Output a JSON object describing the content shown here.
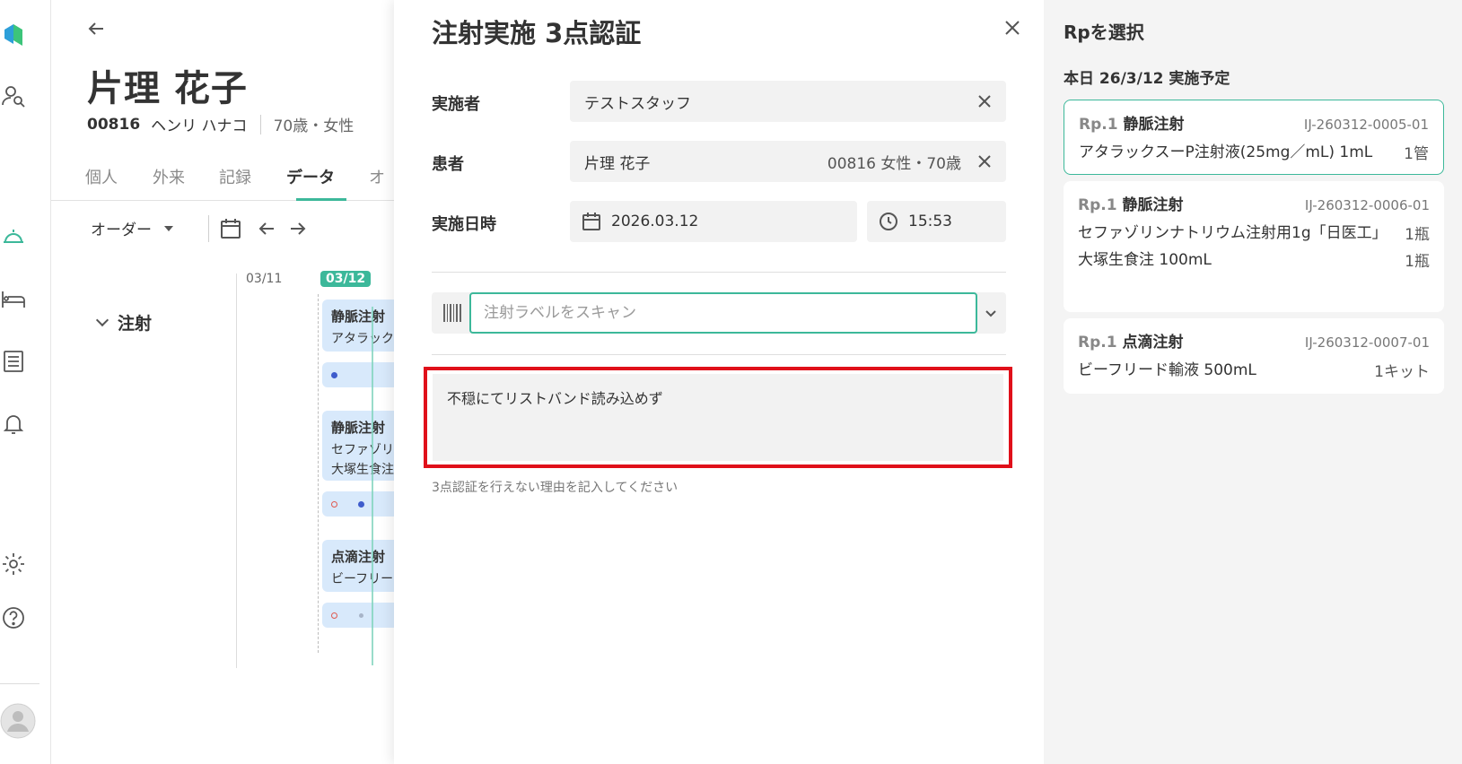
{
  "patient": {
    "name": "片理 花子",
    "id": "00816",
    "kana": "ヘンリ ハナコ",
    "age_sex": "70歳・女性"
  },
  "tabs": [
    "個人",
    "外来",
    "記録",
    "データ",
    "オ"
  ],
  "active_tab": "データ",
  "toolbar": {
    "dropdown": "オーダー"
  },
  "timeline": {
    "date_prev": "03/11",
    "date_today": "03/12",
    "section": "注射",
    "cards": [
      {
        "title": "静脈注射",
        "lines": [
          "アタラック"
        ]
      },
      {
        "title": "静脈注射",
        "lines": [
          "セファゾリ",
          "大塚生食注"
        ]
      },
      {
        "title": "点滴注射",
        "lines": [
          "ビーフリー"
        ]
      }
    ]
  },
  "modal": {
    "title": "注射実施 3点認証",
    "performer_label": "実施者",
    "performer_value": "テストスタッフ",
    "patient_label": "患者",
    "patient_value": "片理 花子",
    "patient_meta": "00816 女性・70歳",
    "datetime_label": "実施日時",
    "date_value": "2026.03.12",
    "time_value": "15:53",
    "scan_placeholder": "注射ラベルをスキャン",
    "reason_text": "不穏にてリストバンド読み込めず",
    "reason_hint": "3点認証を行えない理由を記入してください"
  },
  "rp_panel": {
    "title": "Rpを選択",
    "today_label": "本日 26/3/12 実施予定",
    "items": [
      {
        "rp_no": "Rp.1",
        "kind": "静脈注射",
        "code": "IJ-260312-0005-01",
        "drugs": [
          {
            "name": "アタラックスーP注射液(25mg／mL) 1mL",
            "qty": "1管"
          }
        ]
      },
      {
        "rp_no": "Rp.1",
        "kind": "静脈注射",
        "code": "IJ-260312-0006-01",
        "drugs": [
          {
            "name": "セファゾリンナトリウム注射用1g「日医工」",
            "qty": "1瓶"
          },
          {
            "name": "大塚生食注 100mL",
            "qty": "1瓶"
          }
        ]
      },
      {
        "rp_no": "Rp.1",
        "kind": "点滴注射",
        "code": "IJ-260312-0007-01",
        "drugs": [
          {
            "name": "ビーフリード輸液 500mL",
            "qty": "1キット"
          }
        ]
      }
    ]
  },
  "colors": {
    "accent": "#3cb89a",
    "highlight_border": "#e0101a",
    "card_bg": "#d8e9fb",
    "field_bg": "#f2f2f2"
  },
  "icons": {
    "rail": [
      "app-logo-icon",
      "patient-search-icon",
      "bell-rest-icon",
      "bed-icon",
      "list-icon",
      "notification-bell-icon",
      "gear-icon",
      "help-icon",
      "avatar-icon"
    ],
    "modal": [
      "close-icon",
      "clear-icon",
      "calendar-icon",
      "clock-icon",
      "barcode-icon",
      "chevron-down-icon"
    ]
  }
}
